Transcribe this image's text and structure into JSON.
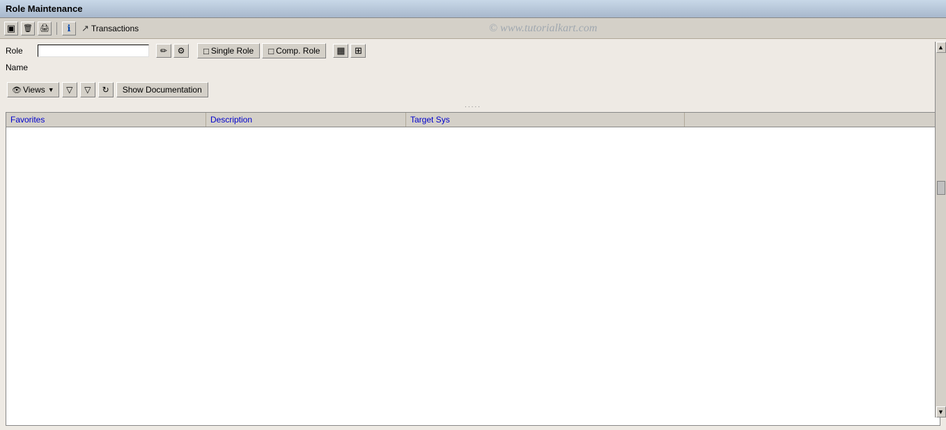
{
  "window": {
    "title": "Role Maintenance"
  },
  "toolbar": {
    "save_icon": "save-icon",
    "delete_icon": "delete-icon",
    "print_icon": "print-icon",
    "info_icon": "info-icon",
    "transactions_label": "Transactions",
    "transactions_icon": "transactions-icon"
  },
  "watermark": {
    "text": "© www.tutorialkart.com"
  },
  "form": {
    "role_label": "Role",
    "role_value": "",
    "name_label": "Name",
    "name_value": "",
    "edit_icon": "edit-icon",
    "settings_icon": "settings-icon",
    "single_role_label": "Single Role",
    "comp_role_label": "Comp. Role",
    "grid1_icon": "grid1-icon",
    "grid2_icon": "grid2-icon"
  },
  "toolbar2": {
    "views_label": "Views",
    "views_dropdown_icon": "chevron-down-icon",
    "filter_icon": "filter-icon",
    "filter2_icon": "filter2-icon",
    "refresh_icon": "refresh-icon",
    "show_documentation_label": "Show Documentation",
    "separator_dots": "....."
  },
  "table": {
    "columns": [
      {
        "id": "favorites",
        "label": "Favorites"
      },
      {
        "id": "description",
        "label": "Description"
      },
      {
        "id": "targetsys",
        "label": "Target Sys"
      },
      {
        "id": "extra",
        "label": ""
      }
    ],
    "rows": []
  }
}
